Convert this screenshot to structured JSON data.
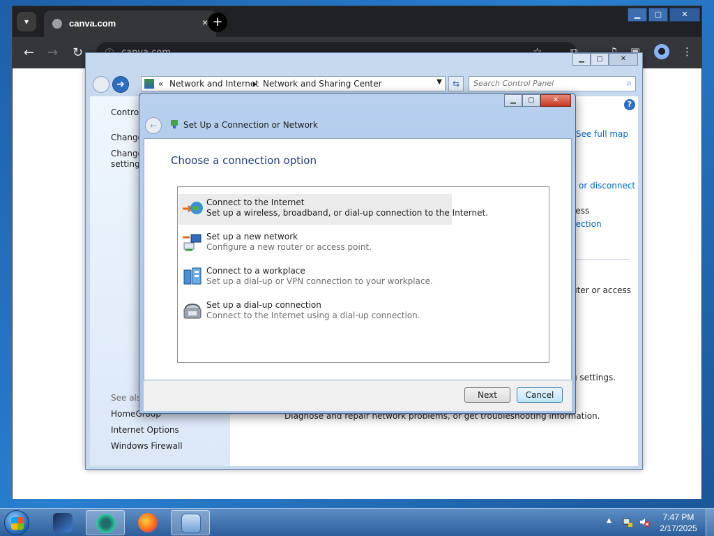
{
  "browser": {
    "tab_title": "canva.com",
    "tab_close": "×",
    "new_tab": "+",
    "url": "canva.com",
    "back": "←",
    "forward": "→",
    "reload": "↻"
  },
  "explorer": {
    "breadcrumb": [
      "«",
      "Network and Internet",
      "▸",
      "Network and Sharing Center"
    ],
    "search_placeholder": "Search Control Panel",
    "left_links": [
      "Control Panel Home",
      "Change adapter settings",
      "Change advanced sharing",
      "settings"
    ],
    "see_also_title": "See also",
    "see_also": [
      "HomeGroup",
      "Internet Options",
      "Windows Firewall"
    ],
    "see_full_map": "See full map",
    "right_fragments": {
      "connect_disconnect": "or disconnect",
      "wireless": "less",
      "connection": "nection",
      "router": "uter or access",
      "sharing": "g settings.",
      "troubleshoot": "Diagnose and repair network problems, or get troubleshooting information."
    },
    "help": "?"
  },
  "dialog": {
    "title": "Set Up a Connection or Network",
    "heading": "Choose a connection option",
    "options": [
      {
        "title": "Connect to the Internet",
        "desc": "Set up a wireless, broadband, or dial-up connection to the Internet.",
        "icon": "globe-icon"
      },
      {
        "title": "Set up a new network",
        "desc": "Configure a new router or access point.",
        "icon": "network-icon"
      },
      {
        "title": "Connect to a workplace",
        "desc": "Set up a dial-up or VPN connection to your workplace.",
        "icon": "workplace-icon"
      },
      {
        "title": "Set up a dial-up connection",
        "desc": "Connect to the Internet using a dial-up connection.",
        "icon": "phone-icon"
      }
    ],
    "next": "Next",
    "cancel": "Cancel"
  },
  "taskbar": {
    "time": "7:47 PM",
    "date": "2/17/2025"
  }
}
